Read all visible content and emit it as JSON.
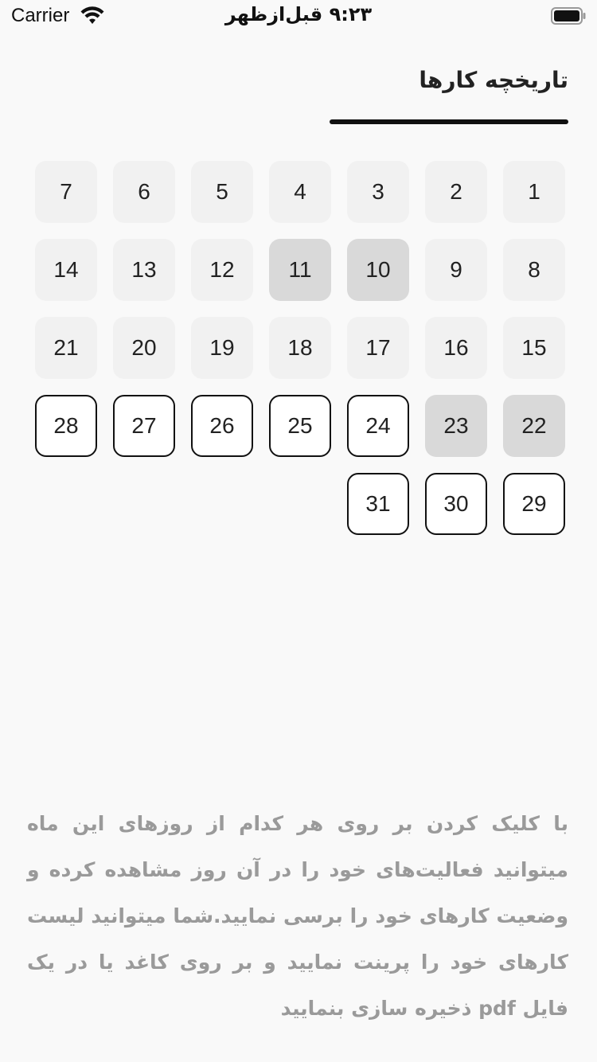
{
  "status_bar": {
    "carrier": "Carrier",
    "time": "۹:۲۳ قبل‌ازظهر"
  },
  "header": {
    "title": "تاریخچه کارها"
  },
  "calendar": {
    "days": [
      {
        "day": "1",
        "state": "past"
      },
      {
        "day": "2",
        "state": "past"
      },
      {
        "day": "3",
        "state": "past"
      },
      {
        "day": "4",
        "state": "past"
      },
      {
        "day": "5",
        "state": "past"
      },
      {
        "day": "6",
        "state": "past"
      },
      {
        "day": "7",
        "state": "past"
      },
      {
        "day": "8",
        "state": "past"
      },
      {
        "day": "9",
        "state": "past"
      },
      {
        "day": "10",
        "state": "done"
      },
      {
        "day": "11",
        "state": "done"
      },
      {
        "day": "12",
        "state": "past"
      },
      {
        "day": "13",
        "state": "past"
      },
      {
        "day": "14",
        "state": "past"
      },
      {
        "day": "15",
        "state": "past"
      },
      {
        "day": "16",
        "state": "past"
      },
      {
        "day": "17",
        "state": "past"
      },
      {
        "day": "18",
        "state": "past"
      },
      {
        "day": "19",
        "state": "past"
      },
      {
        "day": "20",
        "state": "past"
      },
      {
        "day": "21",
        "state": "past"
      },
      {
        "day": "22",
        "state": "done"
      },
      {
        "day": "23",
        "state": "done"
      },
      {
        "day": "24",
        "state": "future"
      },
      {
        "day": "25",
        "state": "future"
      },
      {
        "day": "26",
        "state": "future"
      },
      {
        "day": "27",
        "state": "future"
      },
      {
        "day": "28",
        "state": "future"
      },
      {
        "day": "29",
        "state": "future"
      },
      {
        "day": "30",
        "state": "future"
      },
      {
        "day": "31",
        "state": "future"
      }
    ]
  },
  "description": {
    "text": "با کلیک کردن بر روی هر کدام از روزهای این ماه میتوانید فعالیت‌های خود را در آن روز مشاهده کرده و وضعیت کارهای خود را برسی نمایید.شما میتوانید لیست کارهای خود را پرینت نمایید و بر روی کاغد یا در یک فایل pdf ذخیره سازی بنمایید"
  },
  "icons": {
    "wifi": "wifi-icon",
    "battery": "battery-icon"
  },
  "colors": {
    "past_day": "#f1f1f1",
    "completed_day": "#d9d9d9",
    "future_day_border": "#111111",
    "description_text": "#9a9a9a"
  }
}
